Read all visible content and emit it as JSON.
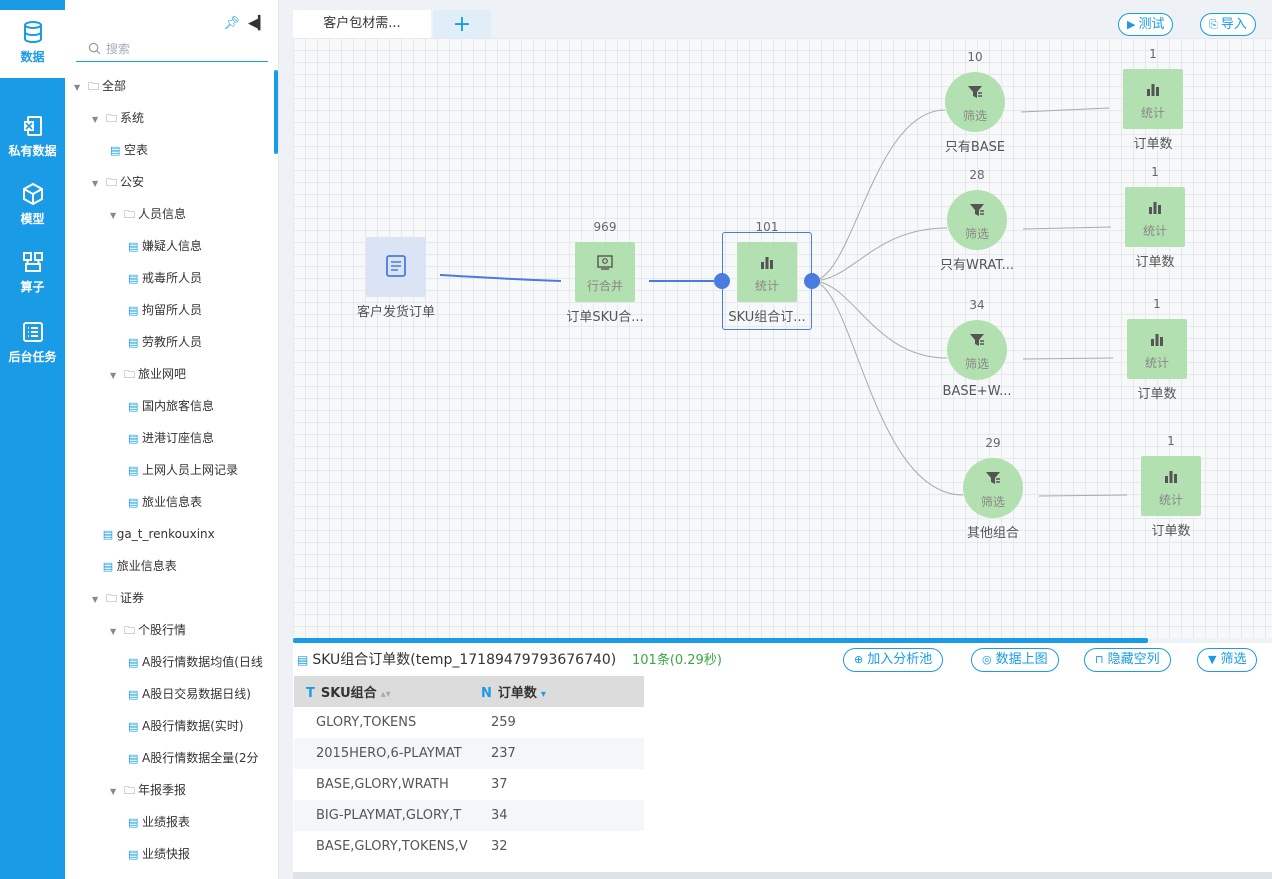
{
  "rail": [
    {
      "label": "数据",
      "icon": "database-icon",
      "active": true
    },
    {
      "label": "私有数据",
      "icon": "excel-file-icon"
    },
    {
      "label": "模型",
      "icon": "cube-icon"
    },
    {
      "label": "算子",
      "icon": "operator-icon"
    },
    {
      "label": "后台任务",
      "icon": "task-list-icon"
    }
  ],
  "tree": {
    "search_placeholder": "搜索",
    "items": [
      {
        "label": "全部",
        "type": "folder",
        "depth": 0
      },
      {
        "label": "系统",
        "type": "folder",
        "depth": 1
      },
      {
        "label": "空表",
        "type": "table",
        "depth": 2
      },
      {
        "label": "公安",
        "type": "folder",
        "depth": 1
      },
      {
        "label": "人员信息",
        "type": "folder",
        "depth": 2
      },
      {
        "label": "嫌疑人信息",
        "type": "table",
        "depth": 3
      },
      {
        "label": "戒毒所人员",
        "type": "table",
        "depth": 3
      },
      {
        "label": "拘留所人员",
        "type": "table",
        "depth": 3
      },
      {
        "label": "劳教所人员",
        "type": "table",
        "depth": 3
      },
      {
        "label": "旅业网吧",
        "type": "folder",
        "depth": 2
      },
      {
        "label": "国内旅客信息",
        "type": "table",
        "depth": 3
      },
      {
        "label": "进港订座信息",
        "type": "table",
        "depth": 3
      },
      {
        "label": "上网人员上网记录",
        "type": "table",
        "depth": 3
      },
      {
        "label": "旅业信息表",
        "type": "table",
        "depth": 3
      },
      {
        "label": "ga_t_renkouxinx",
        "type": "table",
        "depth": 1.6
      },
      {
        "label": "旅业信息表",
        "type": "table",
        "depth": 1.6
      },
      {
        "label": "证券",
        "type": "folder",
        "depth": 1
      },
      {
        "label": "个股行情",
        "type": "folder",
        "depth": 2
      },
      {
        "label": "A股行情数据均值(日线",
        "type": "table",
        "depth": 3
      },
      {
        "label": "A股日交易数据日线)",
        "type": "table",
        "depth": 3
      },
      {
        "label": "A股行情数据(实时)",
        "type": "table",
        "depth": 3
      },
      {
        "label": "A股行情数据全量(2分",
        "type": "table",
        "depth": 3
      },
      {
        "label": "年报季报",
        "type": "folder",
        "depth": 2
      },
      {
        "label": "业绩报表",
        "type": "table",
        "depth": 3
      },
      {
        "label": "业绩快报",
        "type": "table",
        "depth": 3
      }
    ]
  },
  "tabs": {
    "active": "客户包材需...",
    "add": "+"
  },
  "toolbar": {
    "test": "测试",
    "import": "导入"
  },
  "flow": {
    "source": {
      "name": "客户发货订单"
    },
    "merge": {
      "count": "969",
      "sub": "行合并",
      "name": "订单SKU合..."
    },
    "stat": {
      "count": "101",
      "sub": "统计",
      "name": "SKU组合订..."
    },
    "filters": [
      {
        "count": "10",
        "sub": "筛选",
        "name": "只有BASE"
      },
      {
        "count": "28",
        "sub": "筛选",
        "name": "只有WRAT..."
      },
      {
        "count": "34",
        "sub": "筛选",
        "name": "BASE+W..."
      },
      {
        "count": "29",
        "sub": "筛选",
        "name": "其他组合"
      }
    ],
    "stats": [
      {
        "count": "1",
        "sub": "统计",
        "name": "订单数"
      },
      {
        "count": "1",
        "sub": "统计",
        "name": "订单数"
      },
      {
        "count": "1",
        "sub": "统计",
        "name": "订单数"
      },
      {
        "count": "1",
        "sub": "统计",
        "name": "订单数"
      }
    ]
  },
  "result": {
    "title": "SKU组合订单数(temp_17189479793676740)",
    "count": "101条(0.29秒)",
    "buttons": {
      "add_pool": "加入分析池",
      "to_chart": "数据上图",
      "hide_empty": "隐藏空列",
      "filter": "筛选"
    },
    "columns": [
      {
        "type": "T",
        "label": "SKU组合"
      },
      {
        "type": "N",
        "label": "订单数"
      }
    ],
    "rows": [
      [
        "GLORY,TOKENS",
        "259"
      ],
      [
        "2015HERO,6-PLAYMAT",
        "237"
      ],
      [
        "BASE,GLORY,WRATH",
        "37"
      ],
      [
        "BIG-PLAYMAT,GLORY,T",
        "34"
      ],
      [
        "BASE,GLORY,TOKENS,V",
        "32"
      ]
    ]
  }
}
